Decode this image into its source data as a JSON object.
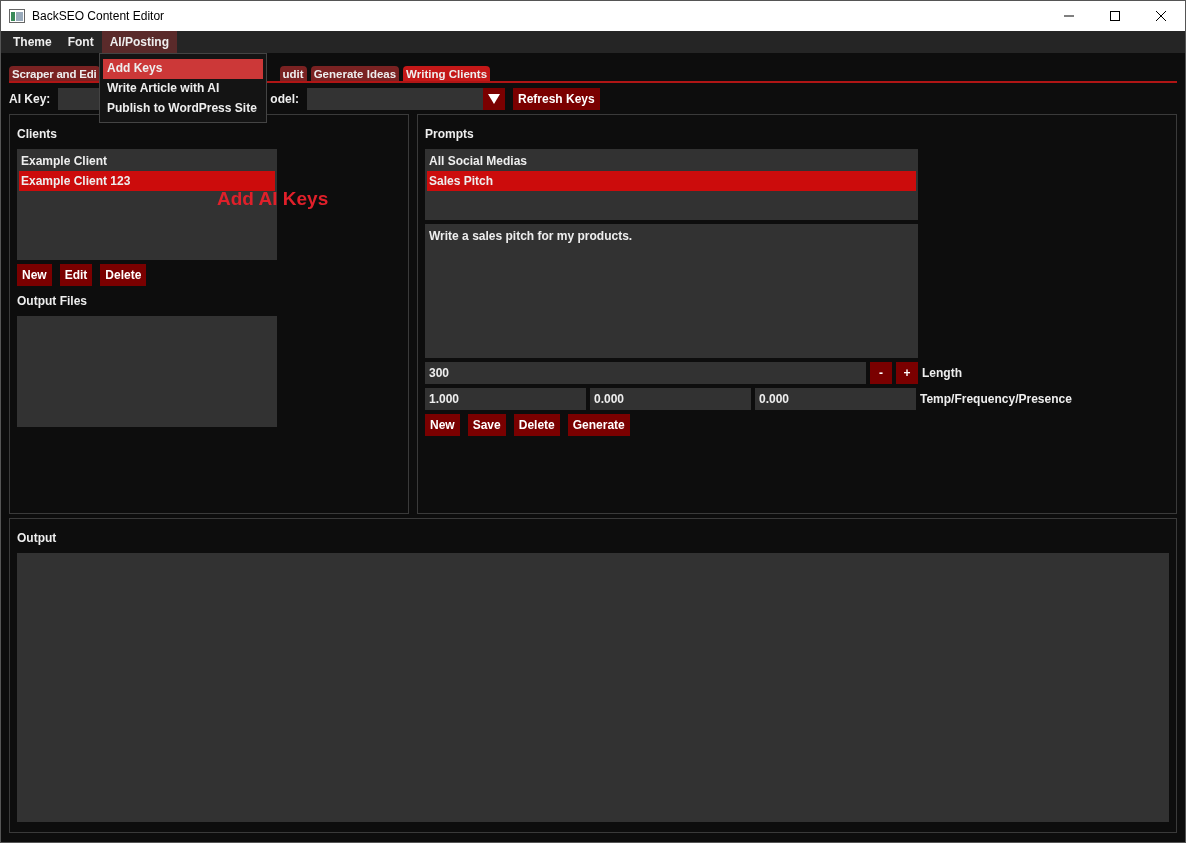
{
  "window": {
    "title": "BackSEO Content Editor"
  },
  "menu_bar": [
    {
      "label": "Theme",
      "selected": false
    },
    {
      "label": "Font",
      "selected": false
    },
    {
      "label": "AI/Posting",
      "selected": true
    }
  ],
  "open_menu": {
    "items": [
      {
        "label": "Add Keys",
        "selected": true
      },
      {
        "label": "Write Article with AI",
        "selected": false
      },
      {
        "label": "Publish to WordPress Site",
        "selected": false
      }
    ]
  },
  "tabs": [
    {
      "label": "Scraper and Edi",
      "selected": false,
      "kind": "left"
    },
    {
      "label": "udit",
      "selected": false,
      "kind": "right"
    },
    {
      "label": "Generate Ideas",
      "selected": false,
      "kind": "right"
    },
    {
      "label": "Writing Clients",
      "selected": true,
      "kind": "right"
    }
  ],
  "key_bar": {
    "ai_key_label": "AI Key:",
    "model_label": "odel:",
    "refresh_button": "Refresh Keys"
  },
  "tooltip": "Add AI Keys",
  "clients": {
    "title": "Clients",
    "items": [
      {
        "label": "Example Client",
        "selected": false
      },
      {
        "label": "Example Client 123",
        "selected": true
      }
    ],
    "buttons": [
      "New",
      "Edit",
      "Delete"
    ],
    "output_files_title": "Output Files"
  },
  "prompts": {
    "title": "Prompts",
    "items": [
      {
        "label": "All Social Medias",
        "selected": false
      },
      {
        "label": "Sales Pitch",
        "selected": true
      }
    ],
    "prompt_text": "Write a sales pitch for my products.",
    "length_value": "300",
    "minus": "-",
    "plus": "+",
    "length_label": "Length",
    "params": [
      "1.000",
      "0.000",
      "0.000"
    ],
    "params_label": "Temp/Frequency/Presence",
    "buttons": [
      "New",
      "Save",
      "Delete",
      "Generate"
    ]
  },
  "output": {
    "title": "Output"
  }
}
